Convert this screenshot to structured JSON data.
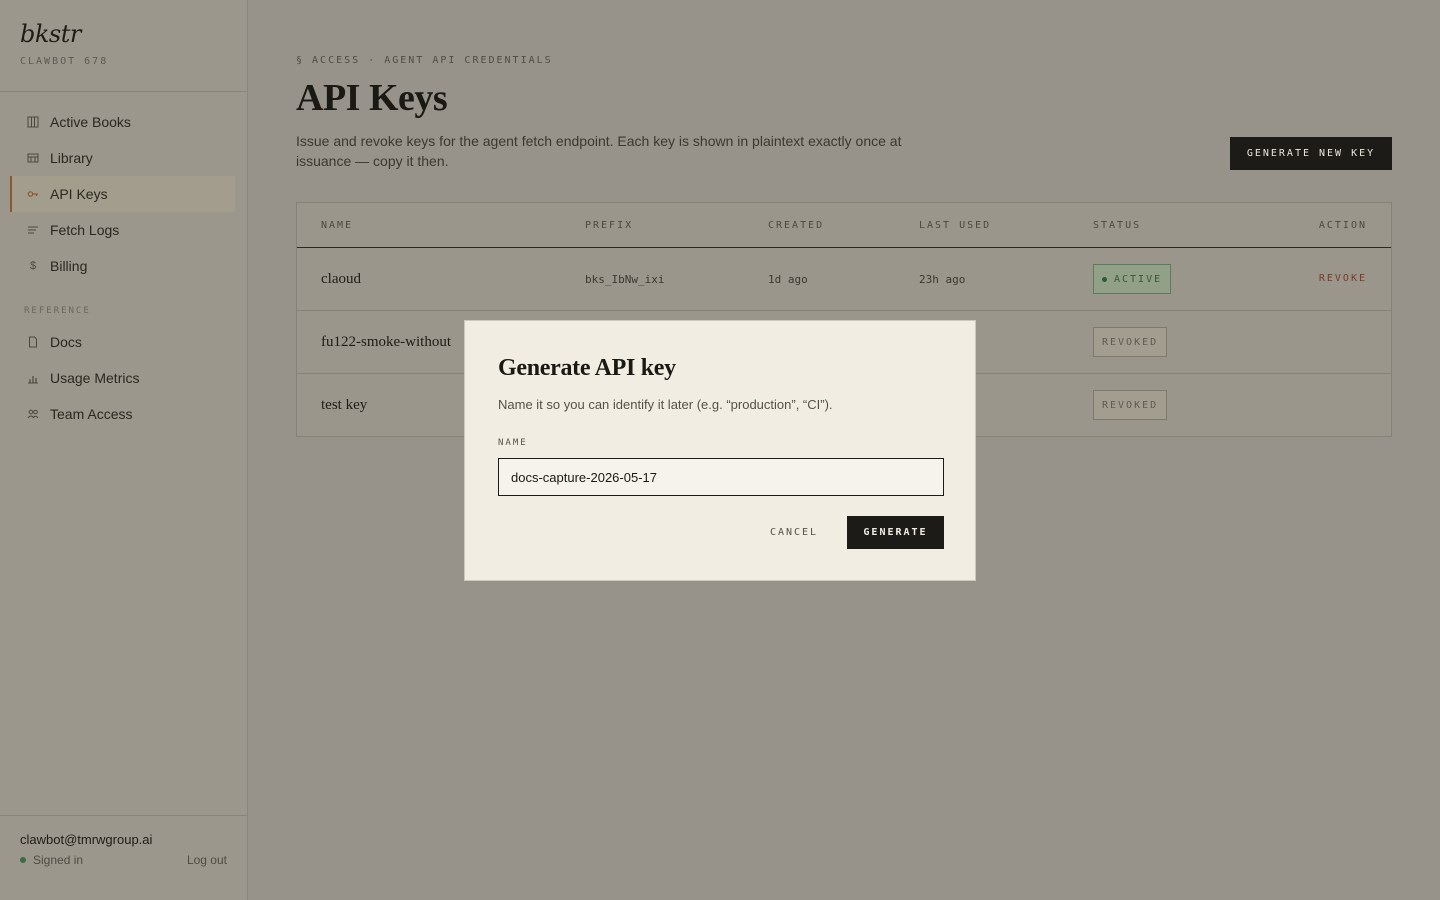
{
  "brand": {
    "logo": "bkstr",
    "org": "CLAWBOT 678"
  },
  "sidebar": {
    "items": [
      {
        "label": "Active Books",
        "icon": "books-icon"
      },
      {
        "label": "Library",
        "icon": "library-icon"
      },
      {
        "label": "API Keys",
        "icon": "key-icon",
        "active": true
      },
      {
        "label": "Fetch Logs",
        "icon": "list-icon"
      },
      {
        "label": "Billing",
        "icon": "dollar-icon"
      }
    ],
    "section_reference": "REFERENCE",
    "reference_items": [
      {
        "label": "Docs",
        "icon": "doc-icon"
      },
      {
        "label": "Usage Metrics",
        "icon": "bar-chart-icon"
      },
      {
        "label": "Team Access",
        "icon": "team-icon"
      }
    ]
  },
  "user": {
    "email": "clawbot@tmrwgroup.ai",
    "status": "Signed in",
    "logout": "Log out"
  },
  "header": {
    "eyebrow": "§ ACCESS · AGENT API CREDENTIALS",
    "title": "API Keys",
    "description": "Issue and revoke keys for the agent fetch endpoint. Each key is shown in plaintext exactly once at issuance — copy it then.",
    "generate_button": "GENERATE NEW KEY"
  },
  "table": {
    "headers": {
      "name": "NAME",
      "prefix": "PREFIX",
      "created": "CREATED",
      "last_used": "LAST USED",
      "status": "STATUS",
      "action": "ACTION"
    },
    "rows": [
      {
        "name": "claoud",
        "prefix": "bks_IbNw_ixi",
        "created": "1d ago",
        "last_used": "23h ago",
        "status": "ACTIVE",
        "action": "REVOKE"
      },
      {
        "name": "fu122-smoke-without",
        "status": "REVOKED"
      },
      {
        "name": "test key",
        "status": "REVOKED"
      }
    ]
  },
  "modal": {
    "title": "Generate API key",
    "description": "Name it so you can identify it later (e.g. “production”, “CI”).",
    "field_label": "NAME",
    "field_value": "docs-capture-2026-05-17",
    "cancel": "CANCEL",
    "generate": "GENERATE"
  },
  "colors": {
    "accent": "#8a5a2e",
    "active": "#2f5a37",
    "danger": "#7a3a22",
    "dark": "#1d1b17"
  }
}
